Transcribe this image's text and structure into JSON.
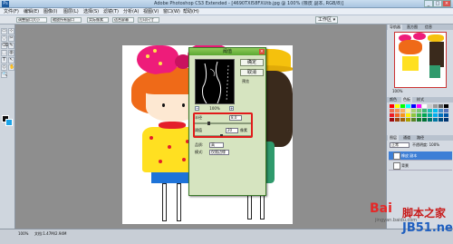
{
  "window": {
    "title": "Adobe Photoshop CS3 Extended - [4690TXI58FXUtb.jpg @ 100% (橡皮 副本, RGB/8)]",
    "app_badge": "Ps",
    "minimize": "_",
    "maximize": "□",
    "close": "×"
  },
  "menu": [
    "文件(F)",
    "编辑(E)",
    "图像(I)",
    "图层(L)",
    "选择(S)",
    "滤镜(T)",
    "分析(A)",
    "视图(V)",
    "窗口(W)",
    "帮助(H)"
  ],
  "options": {
    "items": [
      "调整窗口大小",
      "缩放所有窗口",
      "实际像素",
      "适合屏幕",
      "打印尺寸"
    ],
    "workspace": "工作区 ▾"
  },
  "tools": [
    "▭",
    "⊹",
    "◌",
    "✂",
    "⌫",
    "✎",
    "⬚",
    "◍",
    "T",
    "↖",
    "◇",
    "✋",
    "🔍"
  ],
  "dialog": {
    "title": "阈值",
    "close": "×",
    "ok": "确定",
    "cancel": "取消",
    "preview_label": "预览",
    "zoom_value": "100%",
    "zoom_minus": "−",
    "zoom_plus": "+",
    "field1_label": "半径",
    "field1_value": "8.0",
    "field2_label": "阈值",
    "field2_value": "20",
    "field2_unit": "像素",
    "opt1_label": "品质:",
    "opt1_value": "高",
    "opt2_label": "模式:",
    "opt2_value": "仅限边缘"
  },
  "panels": {
    "navigator_tabs": [
      "导航器",
      "直方图",
      "信息"
    ],
    "zoom_readout": "100%",
    "color_tabs": [
      "颜色",
      "色板",
      "样式"
    ],
    "layers_tabs": [
      "图层",
      "通道",
      "路径"
    ],
    "blend_mode": "正常",
    "opacity": "不透明度: 100%",
    "layers": [
      {
        "name": "橡皮 副本",
        "selected": true
      },
      {
        "name": "背景",
        "selected": false
      }
    ]
  },
  "status": {
    "zoom": "100%",
    "doc": "文档:1.47M/2.94M"
  },
  "watermark": {
    "baidu": "Bai",
    "jingyan": "jingyan.baidu.com",
    "jb51a": "脚本之家",
    "jb51b": "JB51.net"
  },
  "colors": {
    "foreground": "#0d0d0d",
    "background": "#1aa3e8",
    "highlight_box": "#e11b1b",
    "dialog_title": "#5aa832"
  }
}
